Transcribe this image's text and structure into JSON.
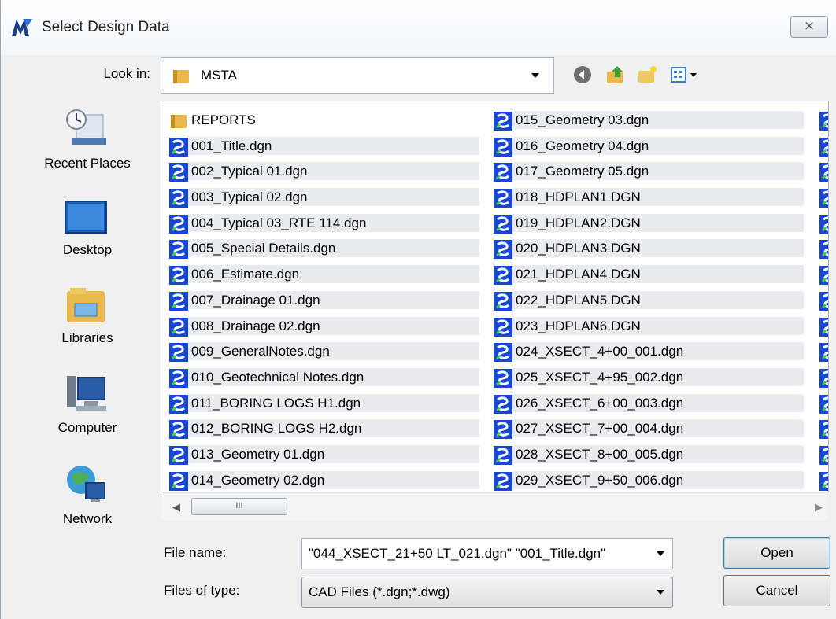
{
  "window": {
    "title": "Select Design Data",
    "close_glyph": "⨯"
  },
  "look_in": {
    "label": "Look in:",
    "value": "MSTA"
  },
  "toolbar": [
    "back-icon",
    "up-folder-icon",
    "new-folder-icon",
    "view-menu-icon"
  ],
  "places": [
    {
      "label": "Recent Places",
      "icon": "recent-places-icon"
    },
    {
      "label": "Desktop",
      "icon": "desktop-icon"
    },
    {
      "label": "Libraries",
      "icon": "libraries-icon"
    },
    {
      "label": "Computer",
      "icon": "computer-icon"
    },
    {
      "label": "Network",
      "icon": "network-icon"
    }
  ],
  "files": {
    "column1": [
      {
        "name": "REPORTS",
        "type": "folder"
      },
      {
        "name": "001_Title.dgn",
        "type": "dgn"
      },
      {
        "name": "002_Typical 01.dgn",
        "type": "dgn"
      },
      {
        "name": "003_Typical 02.dgn",
        "type": "dgn"
      },
      {
        "name": "004_Typical 03_RTE 114.dgn",
        "type": "dgn"
      },
      {
        "name": "005_Special Details.dgn",
        "type": "dgn"
      },
      {
        "name": "006_Estimate.dgn",
        "type": "dgn"
      },
      {
        "name": "007_Drainage 01.dgn",
        "type": "dgn"
      },
      {
        "name": "008_Drainage 02.dgn",
        "type": "dgn"
      },
      {
        "name": "009_GeneralNotes.dgn",
        "type": "dgn"
      },
      {
        "name": "010_Geotechnical Notes.dgn",
        "type": "dgn"
      },
      {
        "name": "011_BORING LOGS H1.dgn",
        "type": "dgn"
      },
      {
        "name": "012_BORING LOGS H2.dgn",
        "type": "dgn"
      },
      {
        "name": "013_Geometry 01.dgn",
        "type": "dgn"
      },
      {
        "name": "014_Geometry 02.dgn",
        "type": "dgn"
      }
    ],
    "column2": [
      {
        "name": "015_Geometry 03.dgn",
        "type": "dgn"
      },
      {
        "name": "016_Geometry 04.dgn",
        "type": "dgn"
      },
      {
        "name": "017_Geometry 05.dgn",
        "type": "dgn"
      },
      {
        "name": "018_HDPLAN1.DGN",
        "type": "dgn"
      },
      {
        "name": "019_HDPLAN2.DGN",
        "type": "dgn"
      },
      {
        "name": "020_HDPLAN3.DGN",
        "type": "dgn"
      },
      {
        "name": "021_HDPLAN4.DGN",
        "type": "dgn"
      },
      {
        "name": "022_HDPLAN5.DGN",
        "type": "dgn"
      },
      {
        "name": "023_HDPLAN6.DGN",
        "type": "dgn"
      },
      {
        "name": "024_XSECT_4+00_001.dgn",
        "type": "dgn"
      },
      {
        "name": "025_XSECT_4+95_002.dgn",
        "type": "dgn"
      },
      {
        "name": "026_XSECT_6+00_003.dgn",
        "type": "dgn"
      },
      {
        "name": "027_XSECT_7+00_004.dgn",
        "type": "dgn"
      },
      {
        "name": "028_XSECT_8+00_005.dgn",
        "type": "dgn"
      },
      {
        "name": "029_XSECT_9+50_006.dgn",
        "type": "dgn"
      }
    ],
    "column3_count": 15
  },
  "scrollbar": {
    "thumb_grip": "III"
  },
  "file_name": {
    "label": "File name:",
    "value": "\"044_XSECT_21+50 LT_021.dgn\" \"001_Title.dgn\""
  },
  "file_type": {
    "label": "Files of type:",
    "value": "CAD Files (*.dgn;*.dwg)"
  },
  "buttons": {
    "open": "Open",
    "cancel": "Cancel"
  }
}
